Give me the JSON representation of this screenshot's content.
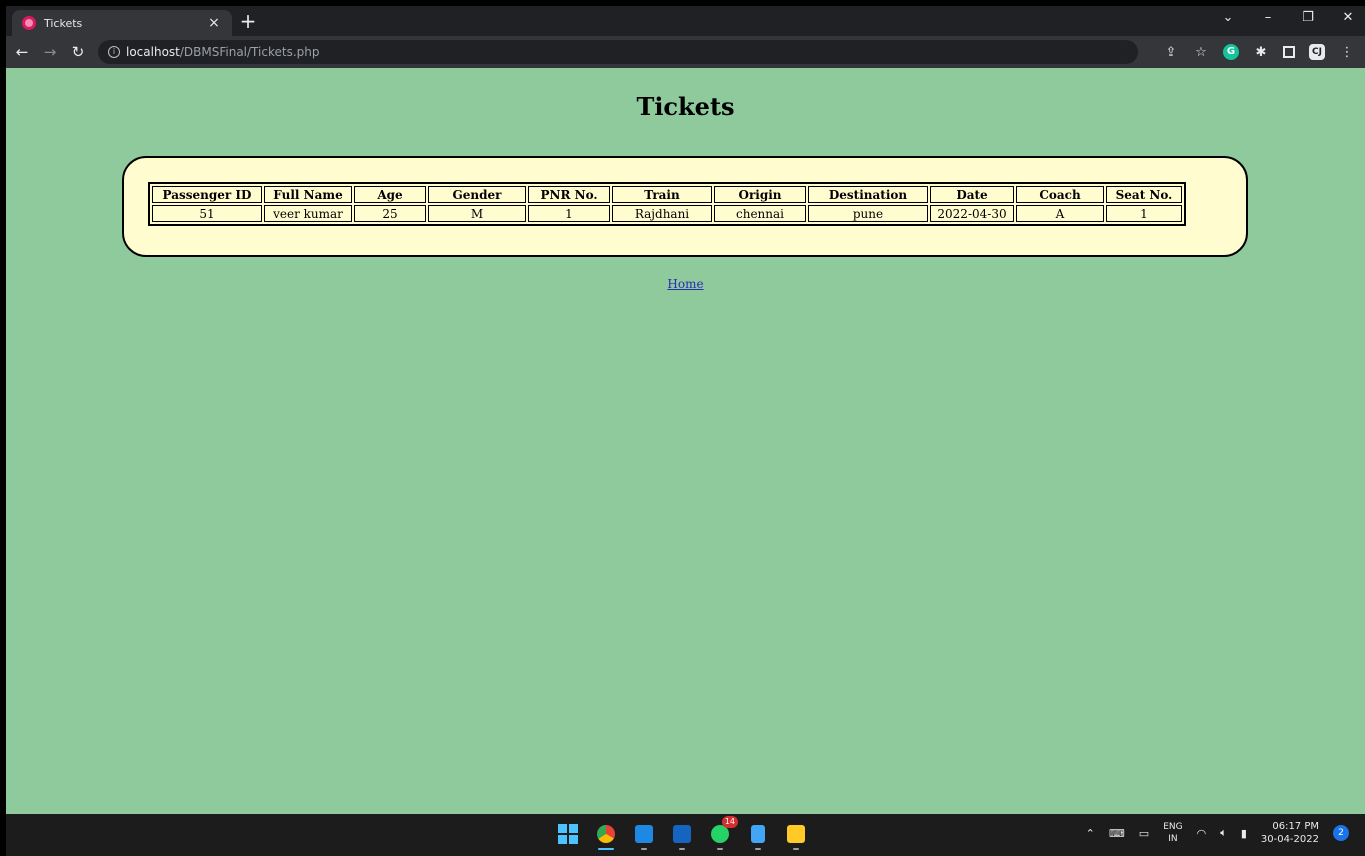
{
  "browser": {
    "tab_title": "Tickets",
    "tab_close": "×",
    "new_tab": "+",
    "url_host": "localhost",
    "url_path": "/DBMSFinal/Tickets.php",
    "window_controls": {
      "dropdown": "⌄",
      "minimize": "–",
      "restore": "❐",
      "close": "✕"
    },
    "extension_g": "G",
    "extension_cj": "CJ"
  },
  "page": {
    "title": "Tickets",
    "table": {
      "headers": [
        "Passenger ID",
        "Full Name",
        "Age",
        "Gender",
        "PNR No.",
        "Train",
        "Origin",
        "Destination",
        "Date",
        "Coach",
        "Seat No."
      ],
      "rows": [
        [
          "51",
          "veer kumar",
          "25",
          "M",
          "1",
          "Rajdhani",
          "chennai",
          "pune",
          "2022-04-30",
          "A",
          "1"
        ]
      ]
    },
    "home_link": "Home"
  },
  "taskbar": {
    "whatsapp_badge": "14",
    "language": "ENG",
    "region": "IN",
    "time": "06:17 PM",
    "date": "30-04-2022",
    "notification_count": "2"
  },
  "colors": {
    "page_background": "#8fca9d",
    "card_background": "#fffdd0",
    "link": "#2b2bb0"
  }
}
